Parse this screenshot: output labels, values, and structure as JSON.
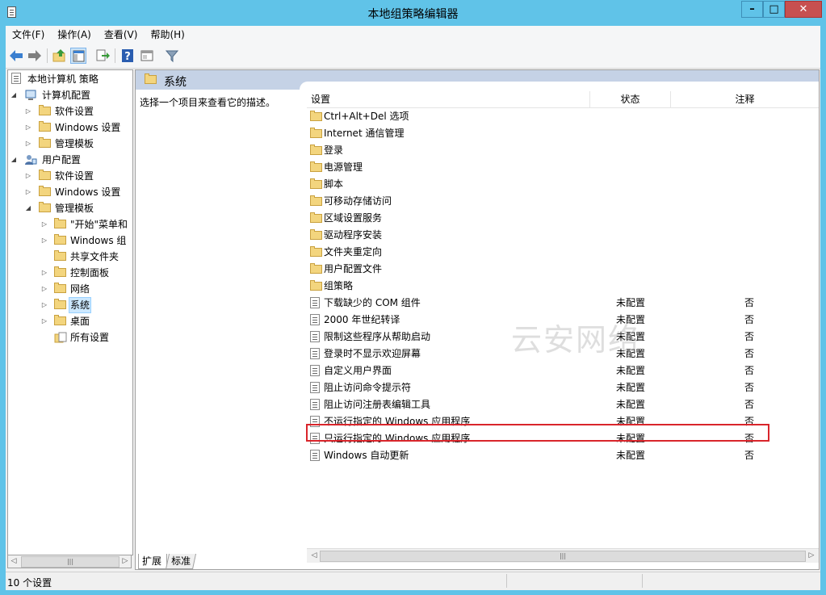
{
  "window": {
    "title": "本地组策略编辑器"
  },
  "menu": [
    "文件(F)",
    "操作(A)",
    "查看(V)",
    "帮助(H)"
  ],
  "tree": {
    "root": "本地计算机 策略",
    "computer_config": "计算机配置",
    "cc_software": "软件设置",
    "cc_windows": "Windows 设置",
    "cc_admin": "管理模板",
    "user_config": "用户配置",
    "uc_software": "软件设置",
    "uc_windows": "Windows 设置",
    "uc_admin": "管理模板",
    "start_menu": "\"开始\"菜单和",
    "win_components": "Windows 组",
    "shared_folders": "共享文件夹",
    "control_panel": "控制面板",
    "network": "网络",
    "system": "系统",
    "desktop": "桌面",
    "all_settings": "所有设置"
  },
  "details": {
    "header": "系统",
    "description": "选择一个项目来查看它的描述。",
    "columns": {
      "setting": "设置",
      "status": "状态",
      "comment": "注释"
    },
    "folders": [
      "Ctrl+Alt+Del 选项",
      "Internet 通信管理",
      "登录",
      "电源管理",
      "脚本",
      "可移动存储访问",
      "区域设置服务",
      "驱动程序安装",
      "文件夹重定向",
      "用户配置文件",
      "组策略"
    ],
    "policies": [
      {
        "name": "下载缺少的 COM 组件",
        "status": "未配置",
        "comment": "否"
      },
      {
        "name": "2000 年世纪转译",
        "status": "未配置",
        "comment": "否"
      },
      {
        "name": "限制这些程序从帮助启动",
        "status": "未配置",
        "comment": "否"
      },
      {
        "name": "登录时不显示欢迎屏幕",
        "status": "未配置",
        "comment": "否"
      },
      {
        "name": "自定义用户界面",
        "status": "未配置",
        "comment": "否"
      },
      {
        "name": "阻止访问命令提示符",
        "status": "未配置",
        "comment": "否"
      },
      {
        "name": "阻止访问注册表编辑工具",
        "status": "未配置",
        "comment": "否"
      },
      {
        "name": "不运行指定的 Windows 应用程序",
        "status": "未配置",
        "comment": "否"
      },
      {
        "name": "只运行指定的 Windows 应用程序",
        "status": "未配置",
        "comment": "否"
      },
      {
        "name": "Windows 自动更新",
        "status": "未配置",
        "comment": "否"
      }
    ],
    "watermark": "云安网络"
  },
  "tabs": {
    "extended": "扩展",
    "standard": "标准"
  },
  "status": {
    "text": "10 个设置"
  },
  "colors": {
    "titlebar": "#60c3e8",
    "highlight": "#d9252b",
    "close": "#c75050"
  }
}
